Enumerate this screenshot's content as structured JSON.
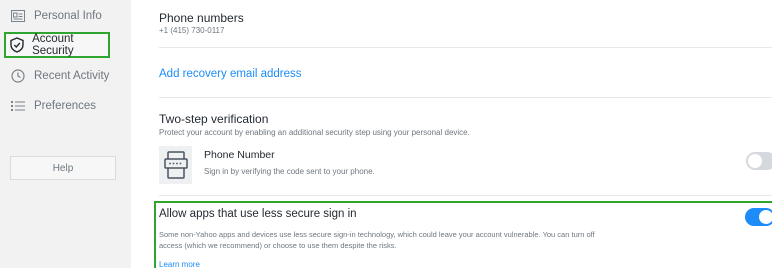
{
  "sidebar": {
    "items": [
      {
        "label": "Personal Info",
        "icon": "id-card-icon"
      },
      {
        "label": "Account Security",
        "icon": "shield-icon",
        "active": true
      },
      {
        "label": "Recent Activity",
        "icon": "clock-icon"
      },
      {
        "label": "Preferences",
        "icon": "list-icon"
      }
    ],
    "help_label": "Help"
  },
  "phone_numbers": {
    "title": "Phone numbers",
    "value": "+1 (415) 730-0117"
  },
  "recovery_email": {
    "link_label": "Add recovery email address"
  },
  "two_step": {
    "title": "Two-step verification",
    "description": "Protect your account by enabling an additional security step using your personal device.",
    "method": {
      "title": "Phone Number",
      "description": "Sign in by verifying the code sent to your phone.",
      "icon": "phone-device-icon",
      "enabled": false
    }
  },
  "less_secure": {
    "title": "Allow apps that use less secure sign in",
    "description_line1": "Some non-Yahoo apps and devices use less secure sign-in technology, which could leave your account vulnerable. You can turn off",
    "description_line2": "access (which we recommend) or choose to use them despite the risks.",
    "learn_more": "Learn more",
    "enabled": true
  },
  "colors": {
    "accent": "#1d8cf8",
    "highlight_border": "#2fa52f",
    "sidebar_bg": "#f2f2f2"
  }
}
